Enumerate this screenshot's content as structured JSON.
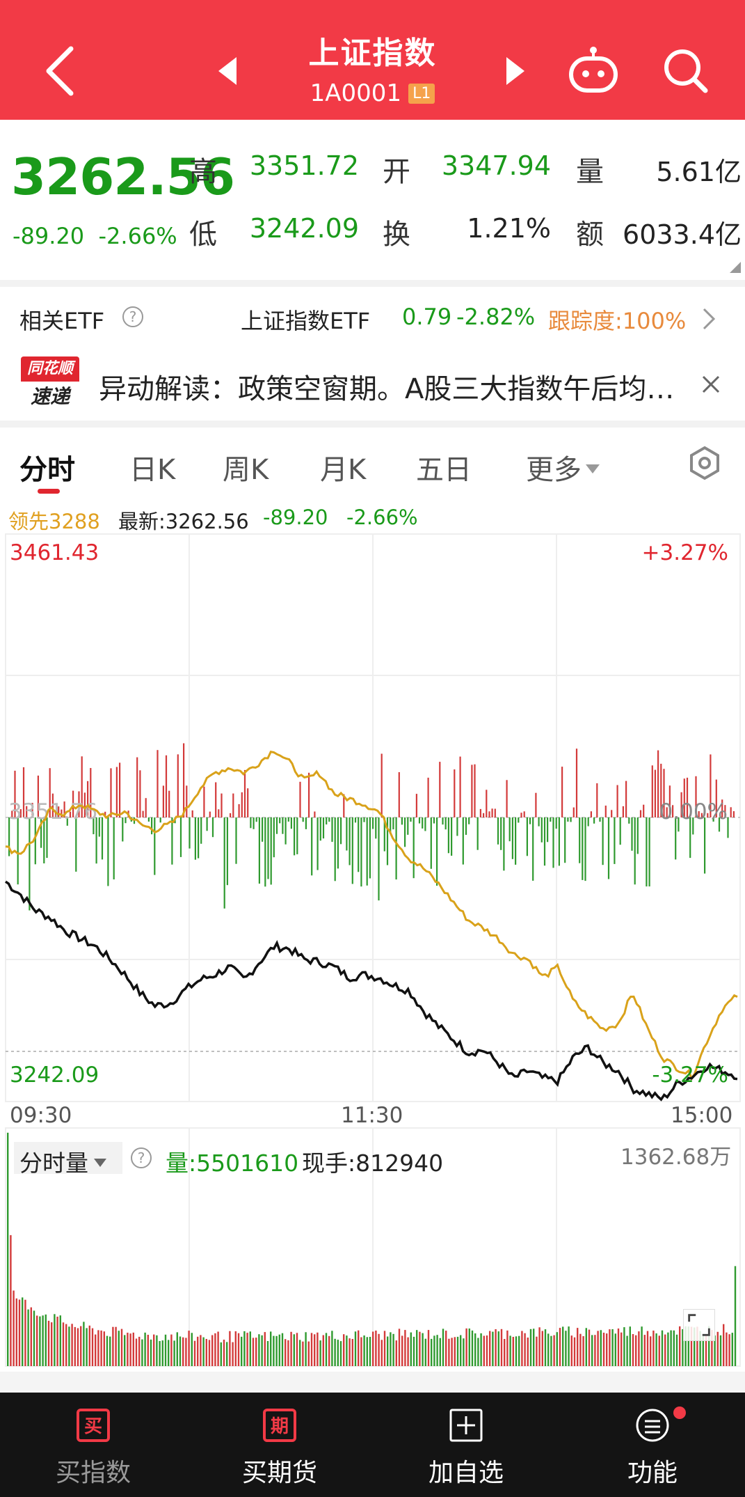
{
  "header": {
    "title": "上证指数",
    "code": "1A0001",
    "level_badge": "L1",
    "icons": [
      "back-arrow-icon",
      "prev-triangle-icon",
      "next-triangle-icon",
      "robot-icon",
      "search-icon"
    ]
  },
  "quote": {
    "price": "3262.56",
    "change": "-89.20",
    "change_pct": "-2.66%",
    "high_label": "高",
    "high": "3351.72",
    "open_label": "开",
    "open": "3347.94",
    "volume_label": "量",
    "volume": "5.61亿",
    "low_label": "低",
    "low": "3242.09",
    "turnover_label": "换",
    "turnover": "1.21%",
    "amount_label": "额",
    "amount": "6033.4亿"
  },
  "etf": {
    "label": "相关ETF",
    "help": "?",
    "name": "上证指数ETF",
    "price": "0.79",
    "change_pct": "-2.82%",
    "tracking": "跟踪度:100%"
  },
  "news": {
    "logo_top": "同花顺",
    "logo_bottom": "速递",
    "text": "异动解读：政策空窗期。A股三大指数午后均…"
  },
  "tabs": {
    "items": [
      "分时",
      "日K",
      "周K",
      "月K",
      "五日",
      "更多"
    ],
    "active_index": 0
  },
  "legend": {
    "lead": "领先3288",
    "latest": "最新:3262.56",
    "change": "-89.20",
    "change_pct": "-2.66%"
  },
  "chart": {
    "y_top": "3461.43",
    "y_top_pct": "+3.27%",
    "y_mid": "3351.76",
    "y_mid_pct": "0.00%",
    "y_bottom": "3242.09",
    "y_bottom_pct": "-3.27%",
    "x_labels": [
      "09:30",
      "11:30",
      "15:00"
    ],
    "colors": {
      "price_line": "#111111",
      "lead_line": "#d9a21a",
      "up": "#d33a3a",
      "down": "#2f9a2f"
    }
  },
  "chart_data": {
    "type": "line",
    "title": "",
    "x_range": [
      "09:30",
      "15:00"
    ],
    "ylim": [
      3242.09,
      3461.43
    ],
    "baseline": 3351.76,
    "series": [
      {
        "values": [
          3327,
          3322,
          3316,
          3313,
          3308,
          3305,
          3302,
          3297,
          3291,
          3284,
          3279,
          3280,
          3285,
          3289,
          3291,
          3294,
          3289,
          3296,
          3302,
          3301,
          3297,
          3296,
          3294,
          3290,
          3291,
          3290,
          3287,
          3285,
          3277,
          3271,
          3266,
          3261,
          3262,
          3257,
          3251,
          3254,
          3251,
          3250,
          3259,
          3263,
          3257,
          3254,
          3247,
          3245,
          3243,
          3249,
          3252,
          3256,
          3254,
          3252
        ]
      },
      {
        "values": [
          3340,
          3338,
          3344,
          3355,
          3353,
          3357,
          3354,
          3352,
          3354,
          3349,
          3347,
          3349,
          3354,
          3363,
          3369,
          3371,
          3369,
          3373,
          3378,
          3373,
          3366,
          3369,
          3361,
          3359,
          3357,
          3354,
          3344,
          3336,
          3332,
          3326,
          3319,
          3312,
          3309,
          3305,
          3299,
          3297,
          3290,
          3294,
          3281,
          3275,
          3270,
          3272,
          3284,
          3270,
          3259,
          3255,
          3252,
          3266,
          3278,
          3283
        ]
      }
    ]
  },
  "volume": {
    "label": "分时量",
    "help": "?",
    "qty": "量:5501610",
    "current": "现手:812940",
    "max": "1362.68万"
  },
  "bottom_nav": {
    "items": [
      {
        "icon_char": "买",
        "label": "买指数"
      },
      {
        "icon_char": "期",
        "label": "买期货"
      },
      {
        "icon_char": "+",
        "label": "加自选"
      },
      {
        "icon_char": "≡",
        "label": "功能"
      }
    ]
  }
}
